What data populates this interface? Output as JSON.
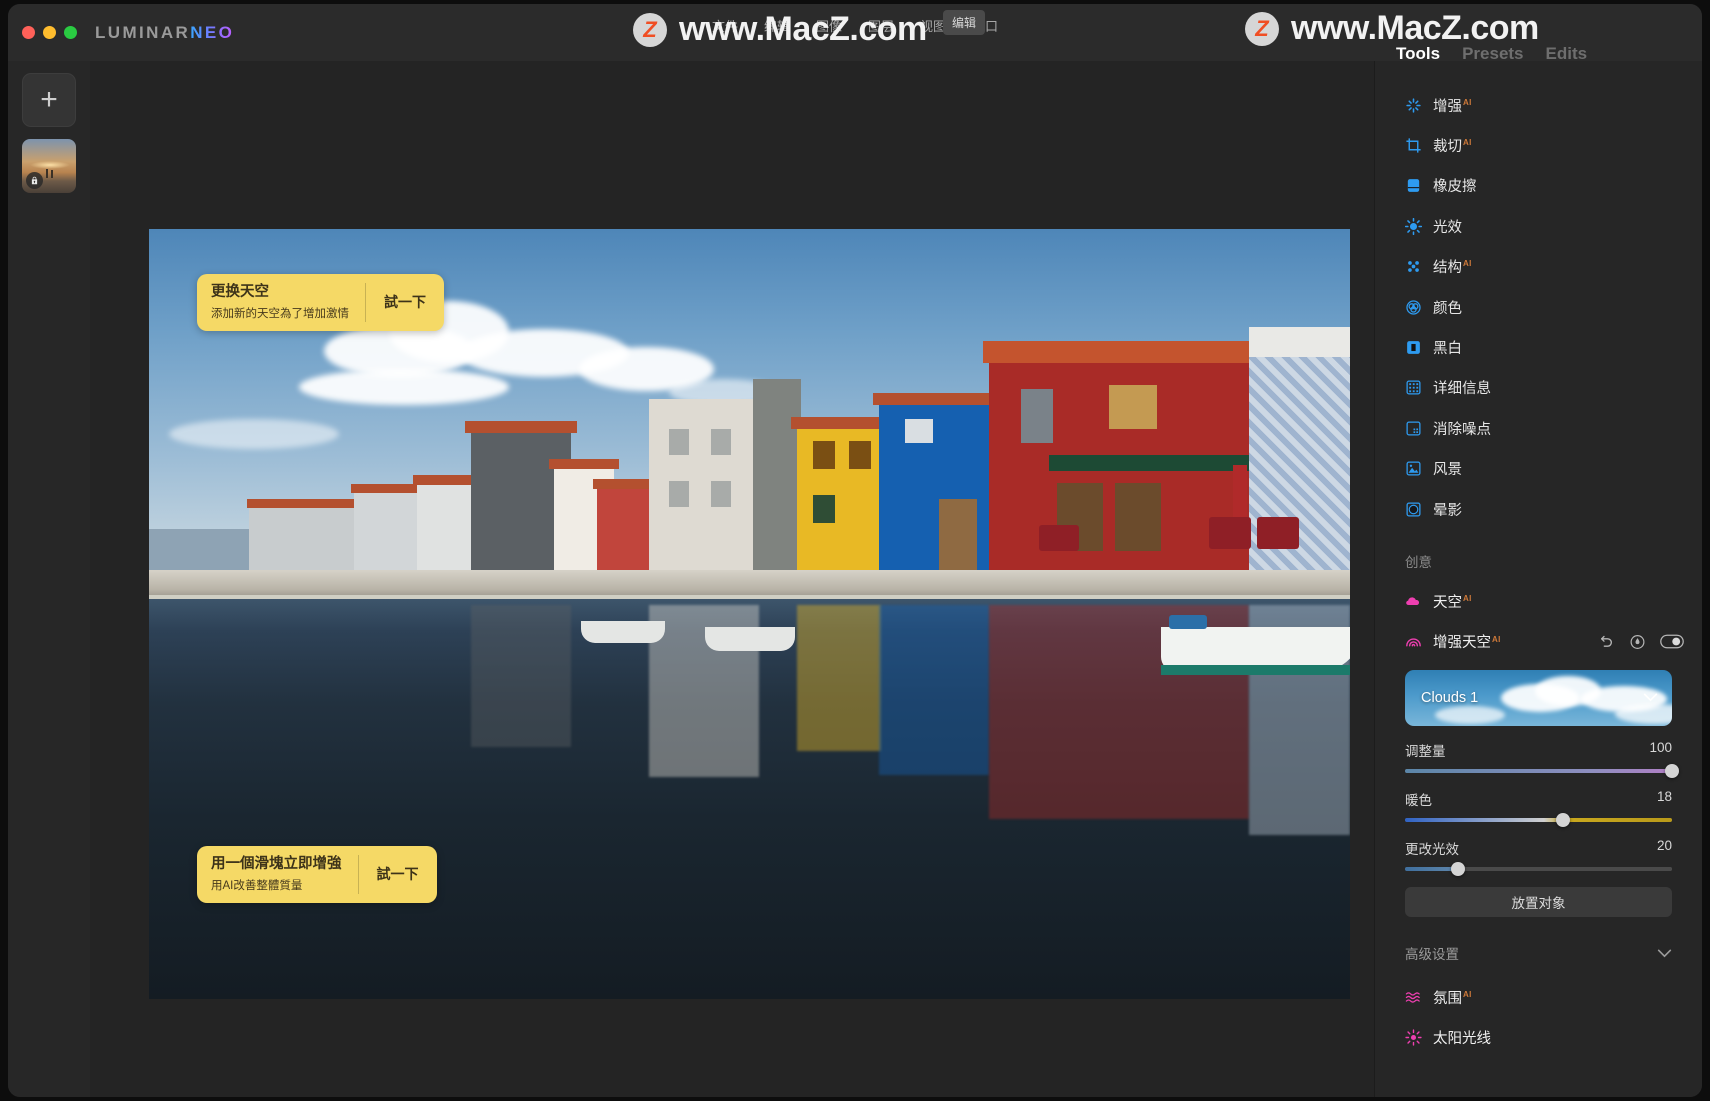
{
  "window": {
    "brand_first": "LUMINAR",
    "brand_second": "NEO"
  },
  "titlebar": {
    "center_menu": [
      "文件",
      "编辑",
      "图像",
      "图层",
      "视图",
      "窗口"
    ],
    "menu_chip": "编辑"
  },
  "watermarks": {
    "center": {
      "badge": "Z",
      "text": "www.MacZ.com"
    },
    "right": {
      "badge": "Z",
      "text": "www.MacZ.com"
    }
  },
  "right_tabs": [
    {
      "label": "Tools",
      "active": true
    },
    {
      "label": "Presets",
      "active": false
    },
    {
      "label": "Edits",
      "active": false
    }
  ],
  "left_rail": {
    "add_label": "+",
    "thumbnail_locked": true
  },
  "tooltips": [
    {
      "title": "更换天空",
      "subtitle": "添加新的天空為了增加激情",
      "cta": "試一下"
    },
    {
      "title": "用一個滑塊立即增強",
      "subtitle": "用AI改善整體質量",
      "cta": "試一下"
    }
  ],
  "tools": [
    {
      "label": "增强",
      "ai": "AI",
      "icon": "enhance-icon"
    },
    {
      "label": "裁切",
      "ai": "AI",
      "icon": "crop-icon"
    },
    {
      "label": "橡皮擦",
      "ai": "",
      "icon": "eraser-icon"
    },
    {
      "label": "光效",
      "ai": "",
      "icon": "light-icon"
    },
    {
      "label": "结构",
      "ai": "AI",
      "icon": "structure-icon"
    },
    {
      "label": "颜色",
      "ai": "",
      "icon": "color-icon"
    },
    {
      "label": "黑白",
      "ai": "",
      "icon": "blackwhite-icon"
    },
    {
      "label": "详细信息",
      "ai": "",
      "icon": "details-icon"
    },
    {
      "label": "消除噪点",
      "ai": "",
      "icon": "denoise-icon"
    },
    {
      "label": "风景",
      "ai": "",
      "icon": "landscape-icon"
    },
    {
      "label": "晕影",
      "ai": "",
      "icon": "vignette-icon"
    }
  ],
  "creative": {
    "section_label": "创意",
    "items": [
      {
        "label": "天空",
        "ai": "AI",
        "icon": "sky-icon"
      },
      {
        "label": "增强天空",
        "ai": "AI",
        "icon": "sky-enhance-icon"
      }
    ],
    "row_actions": [
      "undo-icon",
      "mask-icon",
      "toggle-icon"
    ],
    "sky_preset": "Clouds 1",
    "sliders": [
      {
        "label": "调整量",
        "value": 100,
        "pct": 100
      },
      {
        "label": "暖色",
        "value": 18,
        "pct": 59
      },
      {
        "label": "更改光效",
        "value": 20,
        "pct": 20
      }
    ],
    "place_object_label": "放置对象",
    "advanced_label": "高级设置",
    "more_items": [
      {
        "label": "氛围",
        "ai": "AI",
        "icon": "atmosphere-icon"
      },
      {
        "label": "太阳光线",
        "ai": "",
        "icon": "sunrays-icon"
      }
    ]
  },
  "colors": {
    "tool_icon": "#2e9bf0",
    "creative_icon": "#ee3fb0",
    "ai_badge": "#cf7a3a",
    "tip_bg": "#f5d966",
    "accent_neo": "#6f7dff"
  }
}
